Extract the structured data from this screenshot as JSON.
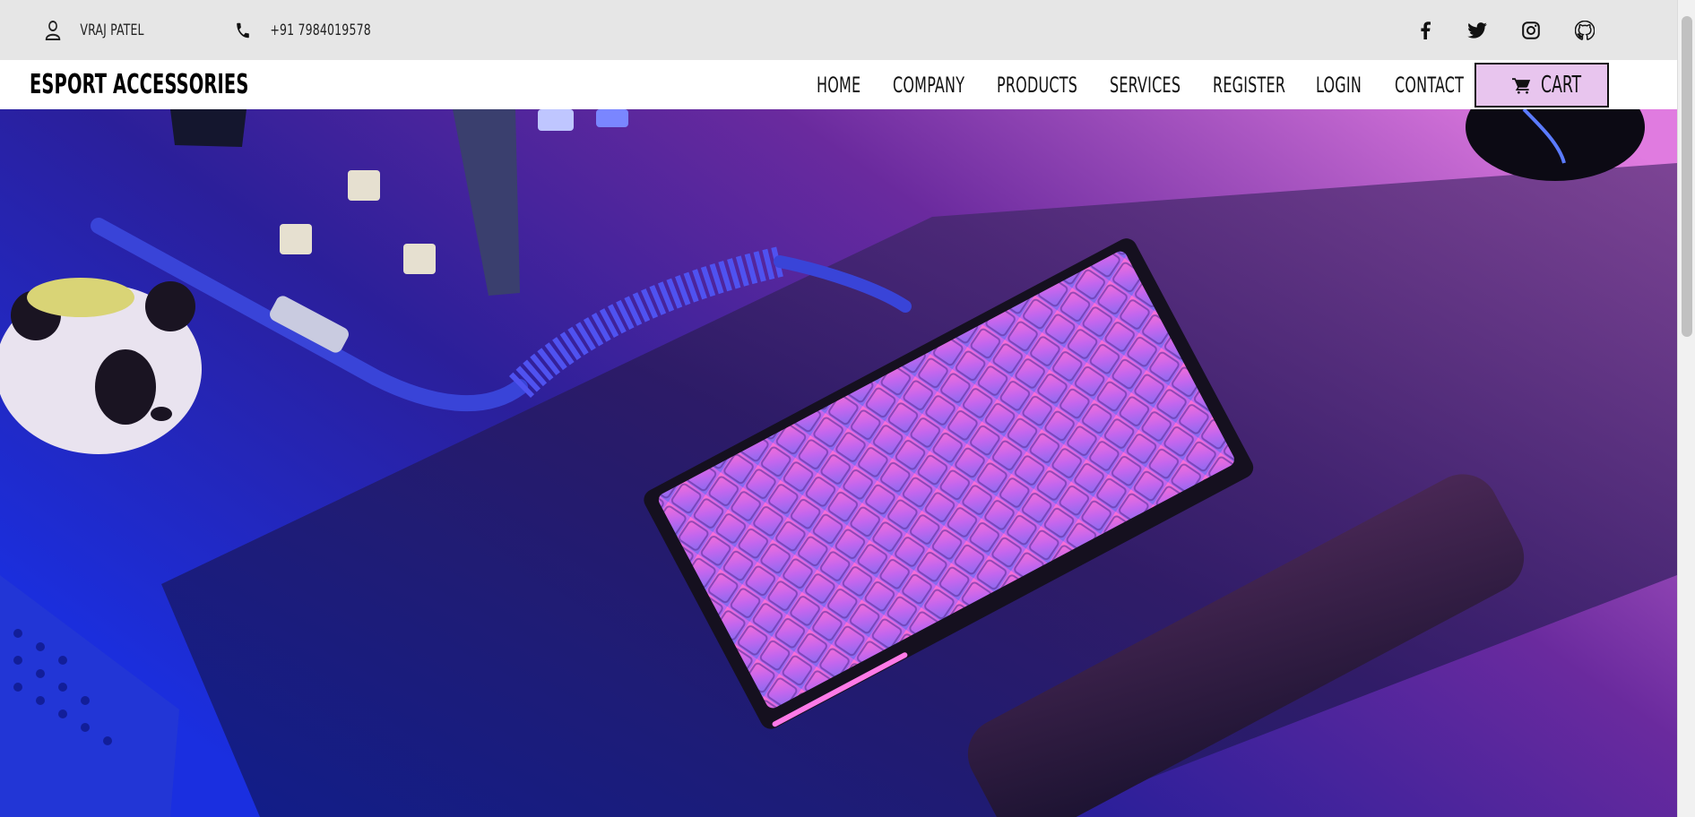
{
  "topbar": {
    "user_name": "VRAJ PATEL",
    "phone": "+91 7984019578",
    "social": [
      "facebook-icon",
      "twitter-icon",
      "instagram-icon",
      "github-icon"
    ]
  },
  "nav": {
    "brand": "ESPORT ACCESSORIES",
    "links": [
      "HOME",
      "COMPANY",
      "PRODUCTS",
      "SERVICES",
      "REGISTER",
      "LOGIN",
      "CONTACT"
    ],
    "cart_label": "CART"
  },
  "colors": {
    "topbar_bg": "#e6e6e6",
    "cart_bg": "#e8c5ee",
    "hero_blue": "#1b2fd6",
    "hero_pink": "#d86fd8"
  },
  "hero": {
    "image": "gaming keyboard with coiled cable, wrist rest, desk mat and panda figure"
  }
}
